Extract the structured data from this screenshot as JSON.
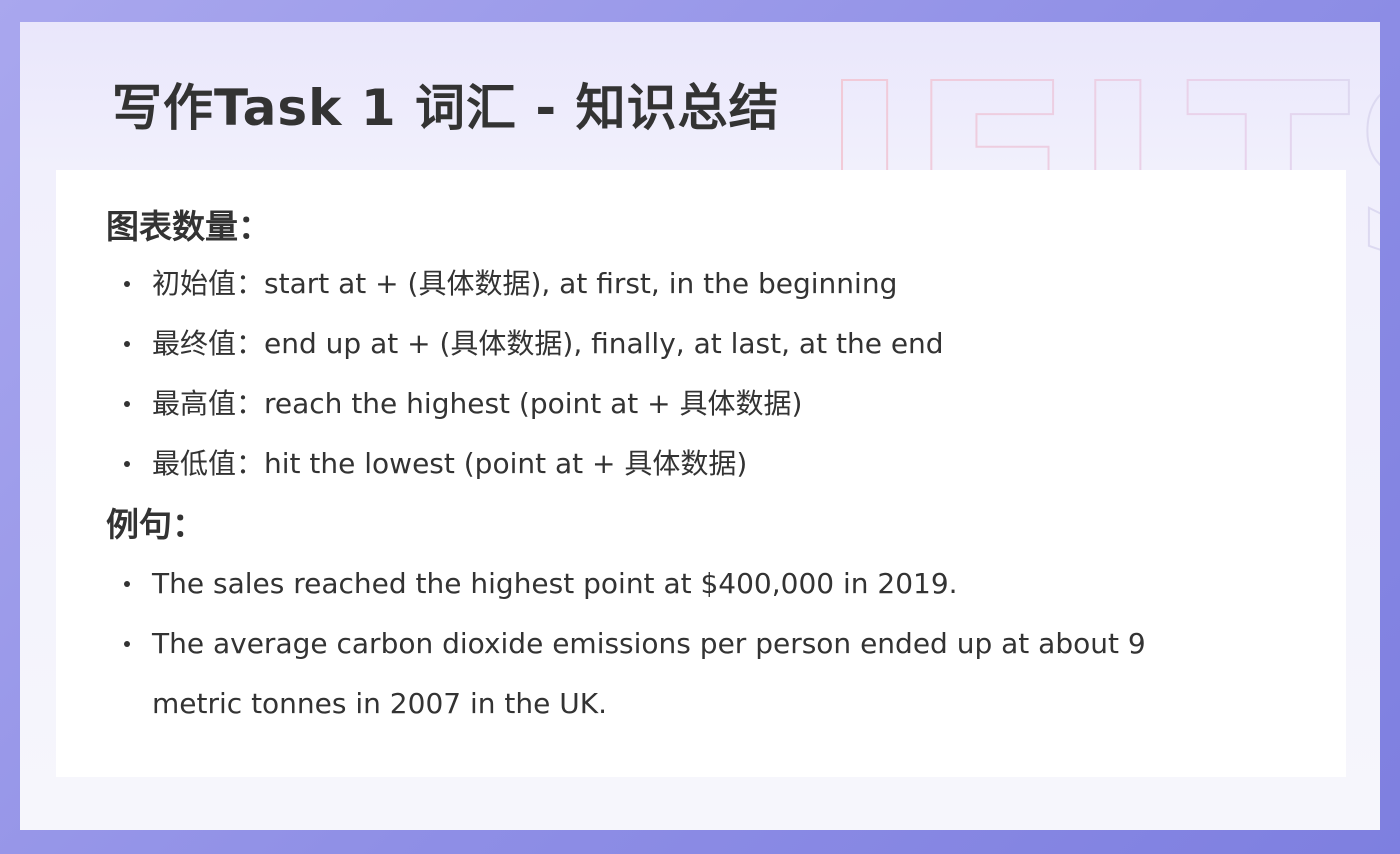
{
  "watermark": {
    "text": "IELTS"
  },
  "title": "写作Task 1 词汇 - 知识总结",
  "sections": [
    {
      "heading": "图表数量：",
      "items": [
        "初始值：start at + (具体数据), at first, in the beginning",
        "最终值：end up at + (具体数据), finally, at last, at the end",
        "最高值：reach the highest (point at + 具体数据)",
        "最低值：hit the lowest (point at + 具体数据)"
      ]
    },
    {
      "heading": "例句：",
      "items": [
        "The sales reached the highest point at $400,000 in 2019.",
        "The average carbon dioxide emissions per person ended up at about 9 metric tonnes in 2007 in the UK."
      ]
    }
  ],
  "colors": {
    "outer_background": "#8f8fe6",
    "text": "#333333",
    "watermark_red": "#f2c9d6",
    "watermark_blue": "#d3def6"
  }
}
